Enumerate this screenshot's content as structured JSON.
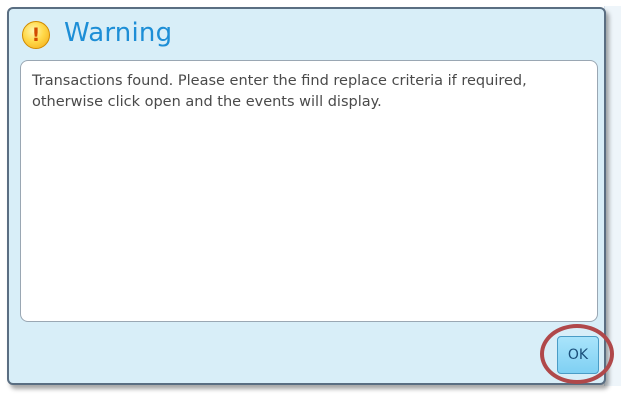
{
  "dialog": {
    "title": "Warning",
    "icon": "warning-icon",
    "icon_glyph": "!",
    "message": "Transactions found. Please enter the find replace criteria if required, otherwise click open and the events will display.",
    "ok_label": "OK"
  },
  "colors": {
    "title": "#1d8ed6",
    "dialog_background": "#d8eef8",
    "ok_button": "#7fd0f3",
    "highlight_ring": "#b0484a"
  }
}
